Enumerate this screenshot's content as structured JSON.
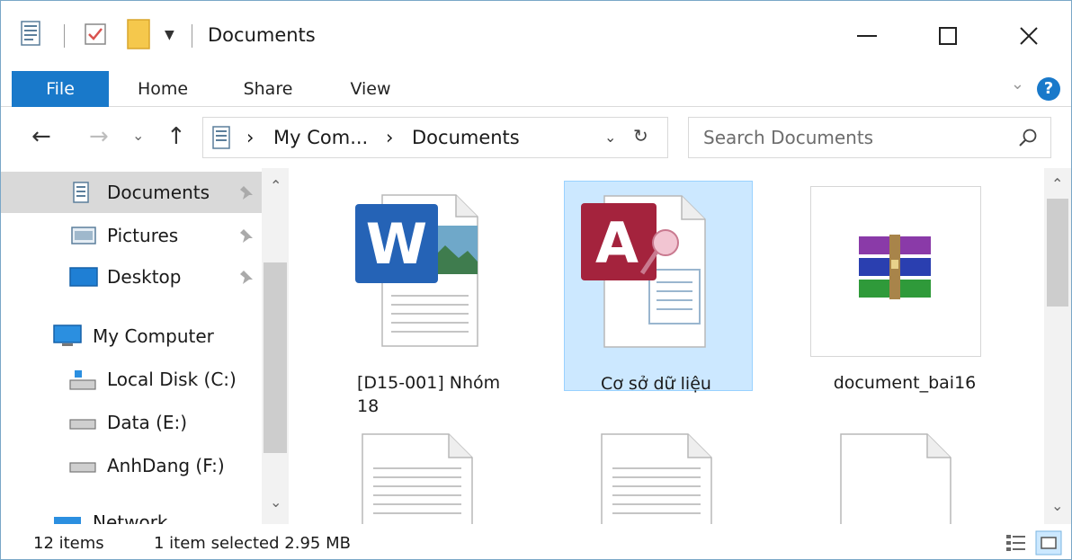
{
  "window": {
    "title": "Documents"
  },
  "ribbon": {
    "tabs": [
      {
        "label": "File"
      },
      {
        "label": "Home"
      },
      {
        "label": "Share"
      },
      {
        "label": "View"
      }
    ],
    "help_icon": "?"
  },
  "address": {
    "crumbs": [
      "My Com...",
      "Documents"
    ],
    "separator": "›"
  },
  "search": {
    "placeholder": "Search Documents"
  },
  "sidebar": {
    "items": [
      {
        "label": "Documents",
        "icon": "documents-icon",
        "pinned": true,
        "active": true
      },
      {
        "label": "Pictures",
        "icon": "pictures-icon",
        "pinned": true
      },
      {
        "label": "Desktop",
        "icon": "desktop-icon",
        "pinned": true
      },
      {
        "label": "My Computer",
        "icon": "computer-icon"
      },
      {
        "label": "Local Disk (C:)",
        "icon": "drive-icon"
      },
      {
        "label": "Data (E:)",
        "icon": "drive-icon"
      },
      {
        "label": "AnhDang (F:)",
        "icon": "drive-icon"
      },
      {
        "label": "Network",
        "icon": "network-icon"
      }
    ]
  },
  "files": [
    {
      "name": "[D15-001] Nhóm 18",
      "icon": "word-document-icon"
    },
    {
      "name": "Cơ sở dữ liệu",
      "icon": "access-database-icon",
      "selected": true
    },
    {
      "name": "document_bai16",
      "icon": "winrar-archive-icon"
    },
    {
      "name": "",
      "icon": "text-document-icon"
    },
    {
      "name": "",
      "icon": "text-document-icon"
    },
    {
      "name": "",
      "icon": "blank-document-icon"
    }
  ],
  "status": {
    "item_count": "12 items",
    "selection": "1 item selected  2.95 MB"
  },
  "colors": {
    "accent": "#1979ca",
    "selection": "#cce8ff",
    "selection_border": "#99d1ff"
  }
}
